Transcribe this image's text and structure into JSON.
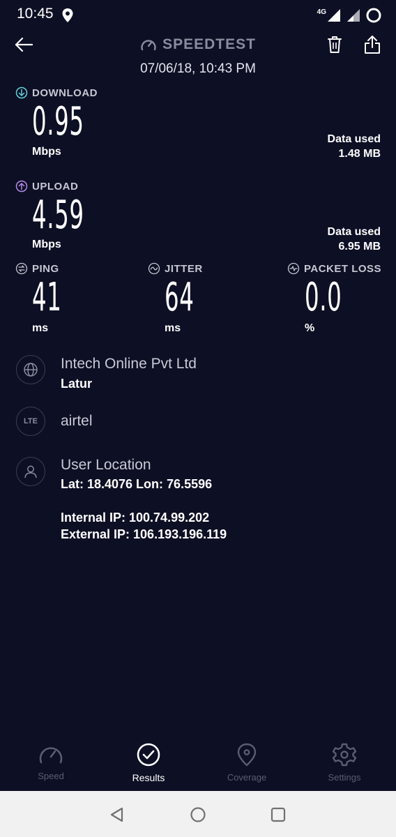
{
  "status_bar": {
    "time": "10:45",
    "network": "4G"
  },
  "header": {
    "title": "SPEEDTEST",
    "date": "07/06/18, 10:43 PM"
  },
  "download": {
    "label": "DOWNLOAD",
    "value": "0.95",
    "unit": "Mbps",
    "data_used_label": "Data used",
    "data_used_value": "1.48 MB"
  },
  "upload": {
    "label": "UPLOAD",
    "value": "4.59",
    "unit": "Mbps",
    "data_used_label": "Data used",
    "data_used_value": "6.95 MB"
  },
  "ping": {
    "label": "PING",
    "value": "41",
    "unit": "ms"
  },
  "jitter": {
    "label": "JITTER",
    "value": "64",
    "unit": "ms"
  },
  "packet_loss": {
    "label": "PACKET LOSS",
    "value": "0.0",
    "unit": "%"
  },
  "provider": {
    "name": "Intech Online Pvt Ltd",
    "city": "Latur"
  },
  "carrier": {
    "badge": "LTE",
    "name": "airtel"
  },
  "location": {
    "title": "User Location",
    "coords": "Lat: 18.4076 Lon: 76.5596",
    "internal_ip": "Internal IP: 100.74.99.202",
    "external_ip": "External IP: 106.193.196.119"
  },
  "nav": {
    "speed": "Speed",
    "results": "Results",
    "coverage": "Coverage",
    "settings": "Settings"
  },
  "colors": {
    "background": "#0d0f24",
    "download_accent": "#5fd3dd",
    "upload_accent": "#b58ae6",
    "muted": "#5b5d72"
  }
}
